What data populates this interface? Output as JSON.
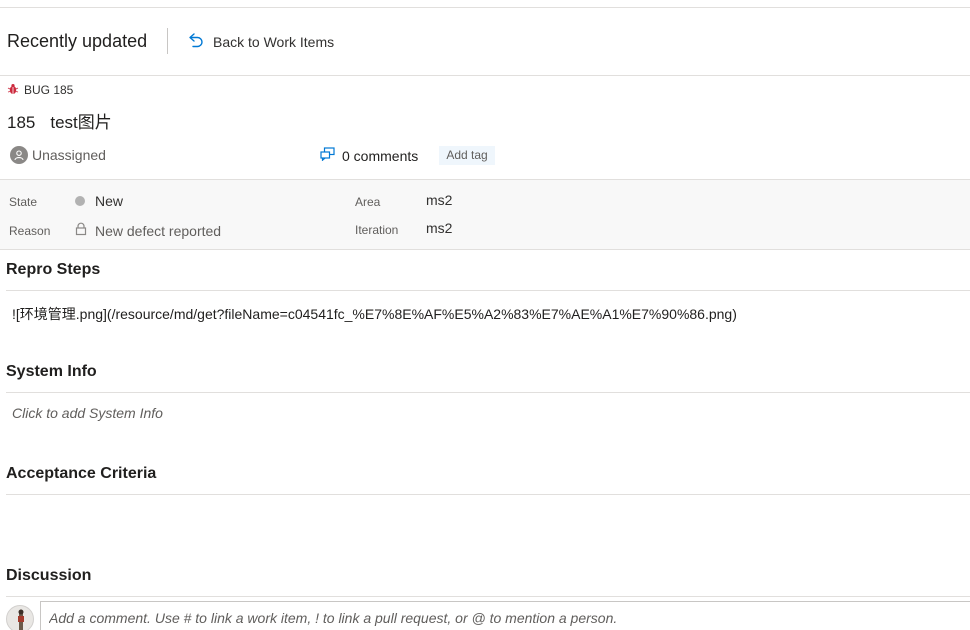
{
  "header": {
    "title": "Recently updated",
    "back_label": "Back to Work Items"
  },
  "work_item": {
    "type_label": "BUG 185",
    "id": "185",
    "title": "test图片",
    "assignee": "Unassigned",
    "comments_label": "0 comments",
    "add_tag_label": "Add tag"
  },
  "fields": {
    "state_label": "State",
    "state_value": "New",
    "reason_label": "Reason",
    "reason_value": "New defect reported",
    "area_label": "Area",
    "area_value": "ms2",
    "iteration_label": "Iteration",
    "iteration_value": "ms2"
  },
  "sections": {
    "repro_title": "Repro Steps",
    "repro_body": "![环境管理.png](/resource/md/get?fileName=c04541fc_%E7%8E%AF%E5%A2%83%E7%AE%A1%E7%90%86.png)",
    "sysinfo_title": "System Info",
    "sysinfo_placeholder": "Click to add System Info",
    "acceptance_title": "Acceptance Criteria",
    "discussion_title": "Discussion"
  },
  "discussion": {
    "placeholder": "Add a comment. Use # to link a work item, ! to link a pull request, or @ to mention a person."
  },
  "colors": {
    "bug_icon": "#cc293d",
    "link_icon": "#0078d4",
    "state_new": "#b2b2b2",
    "tag_bg": "#eff6fc"
  },
  "icons": [
    "back-arrow-icon",
    "bug-icon",
    "unassigned-avatar-icon",
    "comments-icon",
    "lock-icon"
  ]
}
